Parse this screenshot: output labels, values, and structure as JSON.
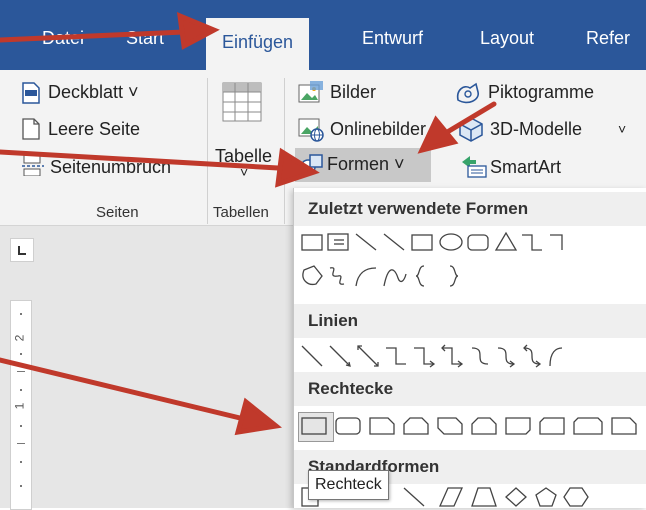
{
  "tabs": [
    {
      "label": "Datei",
      "active": false
    },
    {
      "label": "Start",
      "active": false
    },
    {
      "label": "Einfügen",
      "active": true
    },
    {
      "label": "Entwurf",
      "active": false
    },
    {
      "label": "Layout",
      "active": false
    },
    {
      "label": "Refer",
      "active": false
    }
  ],
  "ribbon": {
    "seiten": {
      "label": "Seiten",
      "deckblatt": "Deckblatt ˅",
      "leere_seite": "Leere Seite",
      "seitenumbruch": "Seitenumbruch"
    },
    "tabellen": {
      "label": "Tabellen",
      "tabelle": "Tabelle",
      "dropdown": "˅"
    },
    "illustrations": {
      "bilder": "Bilder",
      "piktogramme": "Piktogramme",
      "onlinebilder": "Onlinebilder",
      "modelle": "3D-Modelle",
      "modelle_dropdown": "˅",
      "formen": "Formen ˅",
      "smartart": "SmartArt"
    }
  },
  "shapes_menu": {
    "recent": "Zuletzt verwendete Formen",
    "lines": "Linien",
    "rectangles": "Rechtecke",
    "basic": "Standardformen"
  },
  "tooltip": "Rechteck",
  "ruler": {
    "mark_top": "2",
    "mark_bottom": "1"
  },
  "colors": {
    "ribbon_blue": "#2b579a",
    "arrow_red": "#c0392b",
    "hover_highlight": "#c8c8c8"
  }
}
